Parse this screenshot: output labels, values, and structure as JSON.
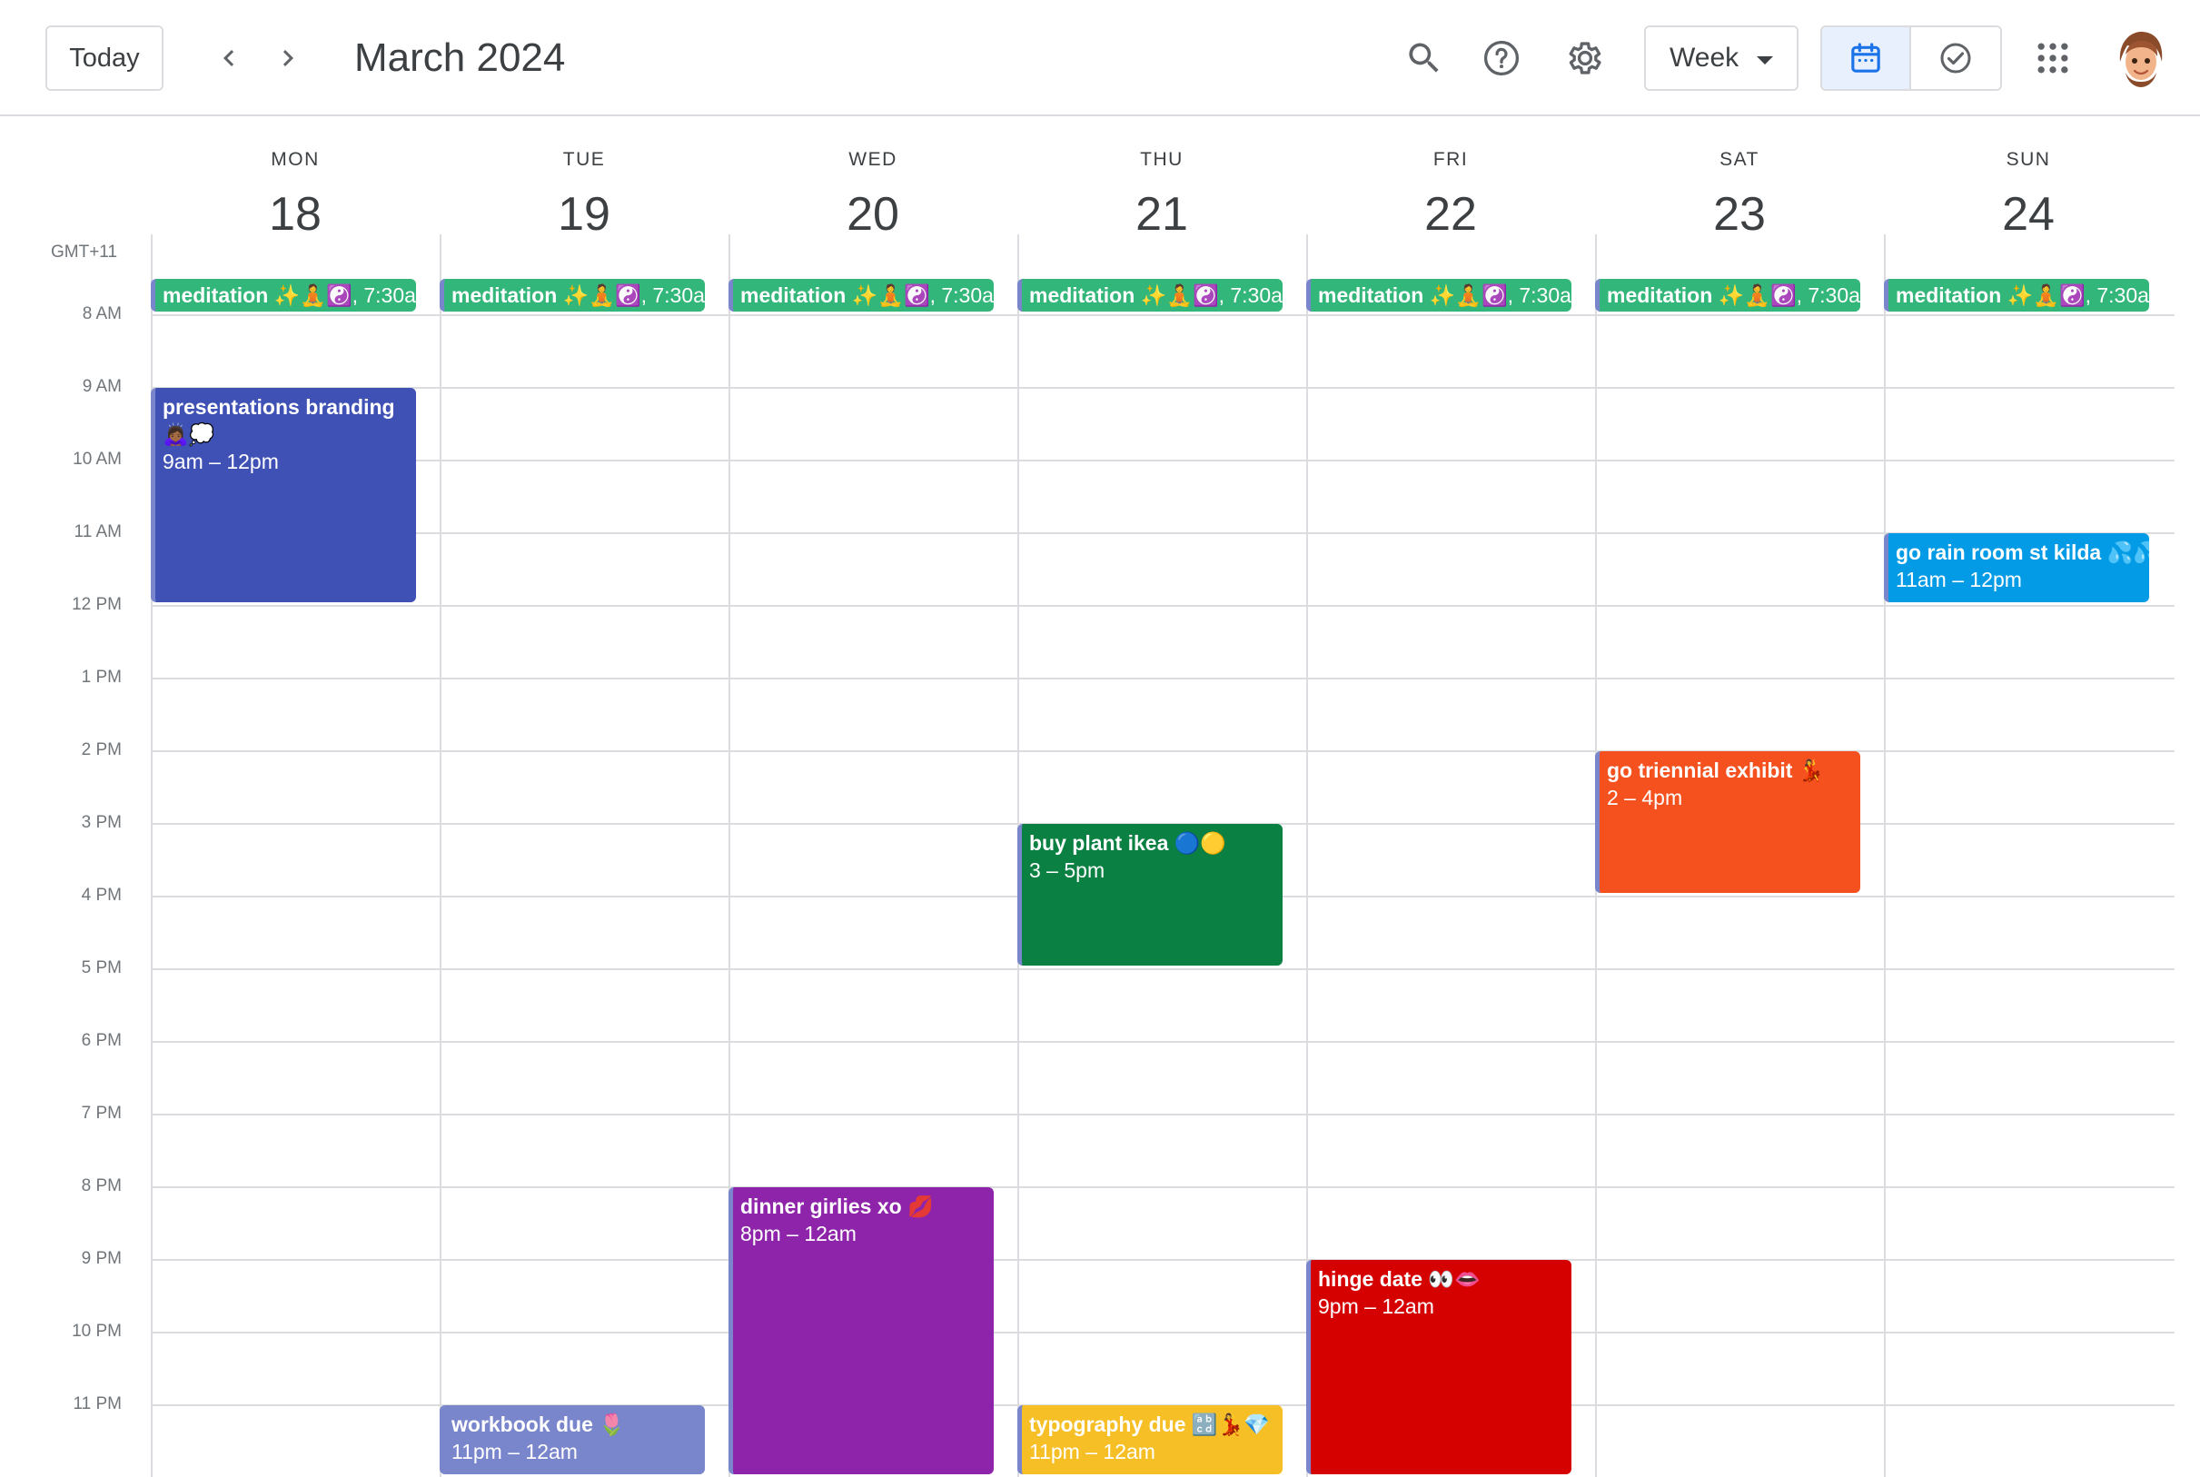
{
  "header": {
    "today_label": "Today",
    "month_title": "March 2024",
    "view_label": "Week"
  },
  "icons": {
    "search": "search-icon",
    "help": "help-circle-icon",
    "settings": "gear-icon",
    "calendar": "calendar-icon",
    "tasks": "check-circle-icon",
    "apps": "apps-grid-icon"
  },
  "timezone": "GMT+11",
  "days": [
    {
      "name": "MON",
      "num": "18"
    },
    {
      "name": "TUE",
      "num": "19"
    },
    {
      "name": "WED",
      "num": "20"
    },
    {
      "name": "THU",
      "num": "21"
    },
    {
      "name": "FRI",
      "num": "22"
    },
    {
      "name": "SAT",
      "num": "23"
    },
    {
      "name": "SUN",
      "num": "24"
    }
  ],
  "hours": [
    "8 AM",
    "9 AM",
    "10 AM",
    "11 AM",
    "12 PM",
    "1 PM",
    "2 PM",
    "3 PM",
    "4 PM",
    "5 PM",
    "6 PM",
    "7 PM",
    "8 PM",
    "9 PM",
    "10 PM",
    "11 PM"
  ],
  "recurring": {
    "title": "meditation ✨🧘☯️",
    "time": ", 7:30am"
  },
  "events": [
    {
      "title": "presentations branding 🙇🏾‍♀️💭",
      "time": "9am – 12pm",
      "color": "#3f51b5"
    },
    {
      "title": "go rain room st kilda 💦💦",
      "time": "11am – 12pm",
      "color": "#039be5"
    },
    {
      "title": "go triennial exhibit 💃",
      "time": "2 – 4pm",
      "color": "#f4511e"
    },
    {
      "title": "buy plant ikea 🔵🟡",
      "time": "3 – 5pm",
      "color": "#0b8043"
    },
    {
      "title": "dinner girlies xo 💋",
      "time": "8pm – 12am",
      "color": "#8e24aa"
    },
    {
      "title": "hinge date 👀👄",
      "time": "9pm – 12am",
      "color": "#d50000"
    },
    {
      "title": "workbook due 🌷",
      "time": "11pm – 12am",
      "color": "#7986cb"
    },
    {
      "title": "typography due 🔡💃💎",
      "time": "11pm – 12am",
      "color": "#f6bf26"
    }
  ],
  "colors": {
    "meditation": "#33b679",
    "accent": "#1a73e8",
    "grid_line": "#dadce0"
  }
}
